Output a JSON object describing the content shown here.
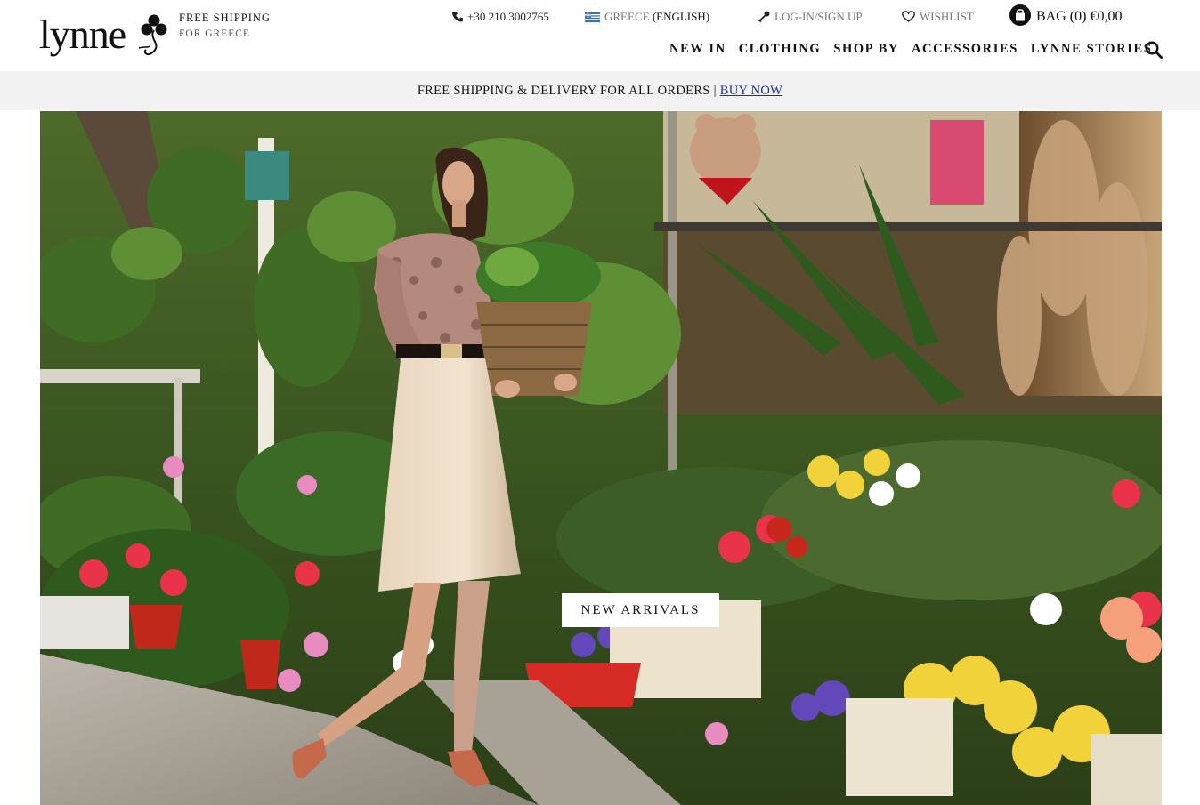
{
  "brand": {
    "logo_text": "lynne"
  },
  "free_shipping": {
    "line1": "FREE SHIPPING",
    "line2": "FOR GREECE"
  },
  "topbar": {
    "phone": "+30 210 3002765",
    "country": "GREECE",
    "language": "(ENGLISH)",
    "login": "LOG-IN/SIGN UP",
    "wishlist": "WISHLIST",
    "bag": "BAG (0) €0,00"
  },
  "nav": {
    "items": [
      {
        "label": "NEW IN"
      },
      {
        "label": "CLOTHING"
      },
      {
        "label": "SHOP BY"
      },
      {
        "label": "ACCESSORIES"
      },
      {
        "label": "LYNNE STORIES"
      }
    ]
  },
  "promo": {
    "text": "FREE SHIPPING & DELIVERY FOR ALL ORDERS |",
    "link": "BUY NOW"
  },
  "hero": {
    "cta_label": "NEW ARRIVALS"
  },
  "colors": {
    "accent_link": "#1a2fa8",
    "promo_bg": "#f2f2f2",
    "text": "#111111"
  },
  "icons": [
    "clover-icon",
    "phone-icon",
    "greek-flag-icon",
    "key-icon",
    "heart-icon",
    "bag-icon",
    "search-icon"
  ]
}
